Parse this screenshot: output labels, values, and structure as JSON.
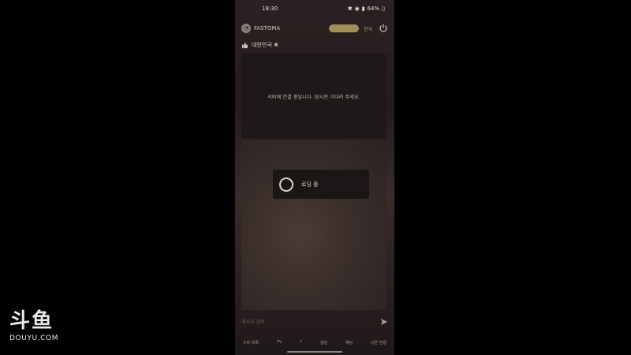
{
  "status_bar": {
    "time": "18:30",
    "icons": [
      "bluetooth-icon",
      "wifi-icon",
      "signal-icon",
      "battery-icon"
    ],
    "battery": "64%"
  },
  "header": {
    "app_name": "FASTOMA",
    "badge": "",
    "lang_label": "한국 ",
    "icons": [
      "power-icon"
    ]
  },
  "title_row": {
    "title": "대한민국 ❀"
  },
  "message": {
    "text": "서버에 연결 중입니다. 잠시만 기다려 주세요."
  },
  "loading": {
    "text": "로딩 중"
  },
  "chat": {
    "placeholder": "메시지 입력"
  },
  "bottom_bar": {
    "items": [
      "서버 목록",
      "TV",
      "?",
      "설정",
      "채팅",
      "다른 방법"
    ]
  },
  "watermark": {
    "logo": "斗鱼",
    "text": "DOUYU.COM"
  },
  "colors": {
    "background": "#000000",
    "phone_bg": "#2b2122",
    "accent_gold": "#c9b66a",
    "text": "#d9d2cc"
  }
}
